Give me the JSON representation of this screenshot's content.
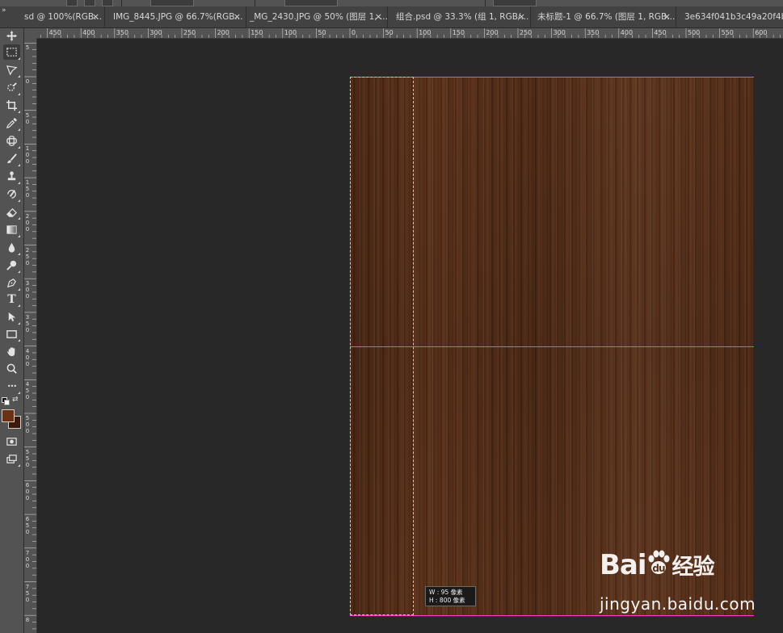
{
  "tabs": [
    {
      "label": "sd @ 100%(RGB...",
      "close": "×"
    },
    {
      "label": "IMG_8445.JPG @ 66.7%(RGB...",
      "close": "×"
    },
    {
      "label": "_MG_2430.JPG @ 50% (图层 1, ...",
      "close": "×"
    },
    {
      "label": "组合.psd @ 33.3% (组 1, RGB/...",
      "close": "×"
    },
    {
      "label": "未标题-1 @ 66.7% (图层 1, RGB...",
      "close": "×"
    },
    {
      "label": "3e634f041b3c49a20f4b4f6...",
      "close": ""
    }
  ],
  "tabbar_collapse": "»",
  "ruler_h_labels": [
    "450",
    "400",
    "350",
    "300",
    "250",
    "200",
    "150",
    "100",
    "50",
    "0",
    "50",
    "100",
    "150",
    "200",
    "250",
    "300",
    "350",
    "400",
    "450",
    "500",
    "550",
    "600"
  ],
  "ruler_v_labels": [
    "5",
    "0",
    "5\n0",
    "1\n0\n0",
    "1\n5\n0",
    "2\n0\n0",
    "2\n5\n0",
    "3\n0\n0",
    "3\n5\n0",
    "4\n0\n0",
    "4\n5\n0",
    "5\n0\n0",
    "5\n5\n0",
    "6\n0\n0",
    "6\n5\n0",
    "7\n0\n0",
    "7\n5\n0",
    "8"
  ],
  "tools": [
    {
      "name": "move-tool",
      "icon": "move-icon"
    },
    {
      "name": "rect-marquee-tool",
      "icon": "marquee-icon",
      "active": true
    },
    {
      "name": "lasso-tool",
      "icon": "lasso-icon"
    },
    {
      "name": "quick-select-tool",
      "icon": "quick-select-icon"
    },
    {
      "name": "crop-tool",
      "icon": "crop-icon"
    },
    {
      "name": "eyedropper-tool",
      "icon": "eyedropper-icon"
    },
    {
      "name": "healing-brush-tool",
      "icon": "healing-icon"
    },
    {
      "name": "brush-tool",
      "icon": "brush-icon"
    },
    {
      "name": "clone-stamp-tool",
      "icon": "stamp-icon"
    },
    {
      "name": "history-brush-tool",
      "icon": "history-brush-icon"
    },
    {
      "name": "eraser-tool",
      "icon": "eraser-icon"
    },
    {
      "name": "gradient-tool",
      "icon": "gradient-icon"
    },
    {
      "name": "blur-tool",
      "icon": "blur-icon"
    },
    {
      "name": "dodge-tool",
      "icon": "dodge-icon"
    },
    {
      "name": "pen-tool",
      "icon": "pen-icon"
    },
    {
      "name": "type-tool",
      "icon": "type-icon"
    },
    {
      "name": "path-select-tool",
      "icon": "arrow-icon"
    },
    {
      "name": "rectangle-tool",
      "icon": "rectangle-icon"
    },
    {
      "name": "hand-tool",
      "icon": "hand-icon"
    },
    {
      "name": "zoom-tool",
      "icon": "zoom-icon"
    },
    {
      "name": "more-tools",
      "icon": "ellipsis-icon"
    }
  ],
  "type_tool_glyph": "T",
  "more_tools_glyph": "•••",
  "colors": {
    "foreground": "#6b3114",
    "background": "#3a1a0a",
    "guide": "#ff3fd4"
  },
  "tooltip": {
    "w_line": "W :   95 像素",
    "h_line": "H : 800 像素"
  },
  "watermark": {
    "brand": "Bai",
    "brand_tail": "经验",
    "url": "jingyan.baidu.com"
  }
}
